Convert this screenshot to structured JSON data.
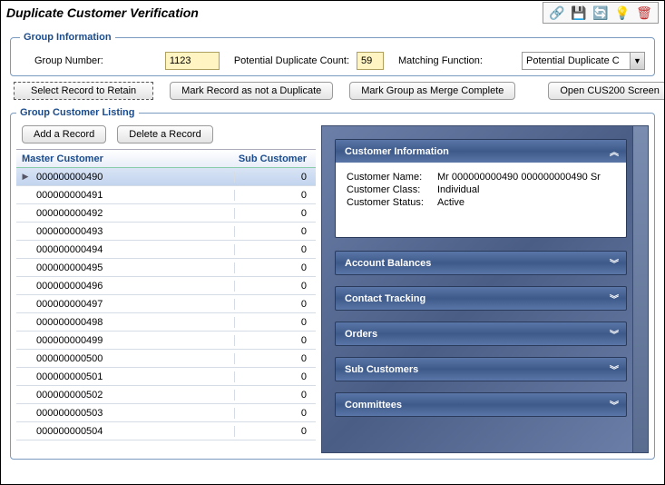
{
  "title": "Duplicate Customer Verification",
  "group_info": {
    "legend": "Group Information",
    "group_number_label": "Group Number:",
    "group_number_value": "1123",
    "dup_count_label": "Potential Duplicate Count:",
    "dup_count_value": "59",
    "matching_fn_label": "Matching Function:",
    "matching_fn_value": "Potential Duplicate C"
  },
  "actions": {
    "select_retain": "Select Record to Retain",
    "mark_not_dup": "Mark Record as not a Duplicate",
    "mark_merge_complete": "Mark Group as Merge Complete",
    "open_cus200": "Open CUS200 Screen"
  },
  "listing": {
    "legend": "Group Customer Listing",
    "add": "Add a Record",
    "delete": "Delete a Record",
    "col_master": "Master Customer",
    "col_sub": "Sub Customer",
    "rows": [
      {
        "master": "000000000490",
        "sub": "0",
        "selected": true
      },
      {
        "master": "000000000491",
        "sub": "0"
      },
      {
        "master": "000000000492",
        "sub": "0"
      },
      {
        "master": "000000000493",
        "sub": "0"
      },
      {
        "master": "000000000494",
        "sub": "0"
      },
      {
        "master": "000000000495",
        "sub": "0"
      },
      {
        "master": "000000000496",
        "sub": "0"
      },
      {
        "master": "000000000497",
        "sub": "0"
      },
      {
        "master": "000000000498",
        "sub": "0"
      },
      {
        "master": "000000000499",
        "sub": "0"
      },
      {
        "master": "000000000500",
        "sub": "0"
      },
      {
        "master": "000000000501",
        "sub": "0"
      },
      {
        "master": "000000000502",
        "sub": "0"
      },
      {
        "master": "000000000503",
        "sub": "0"
      },
      {
        "master": "000000000504",
        "sub": "0"
      }
    ]
  },
  "detail": {
    "cust_info_header": "Customer Information",
    "name_label": "Customer Name:",
    "name_value": "Mr 000000000490 000000000490 Sr",
    "class_label": "Customer Class:",
    "class_value": "Individual",
    "status_label": "Customer Status:",
    "status_value": "Active",
    "panels": {
      "account_balances": "Account Balances",
      "contact_tracking": "Contact Tracking",
      "orders": "Orders",
      "sub_customers": "Sub Customers",
      "committees": "Committees"
    }
  }
}
